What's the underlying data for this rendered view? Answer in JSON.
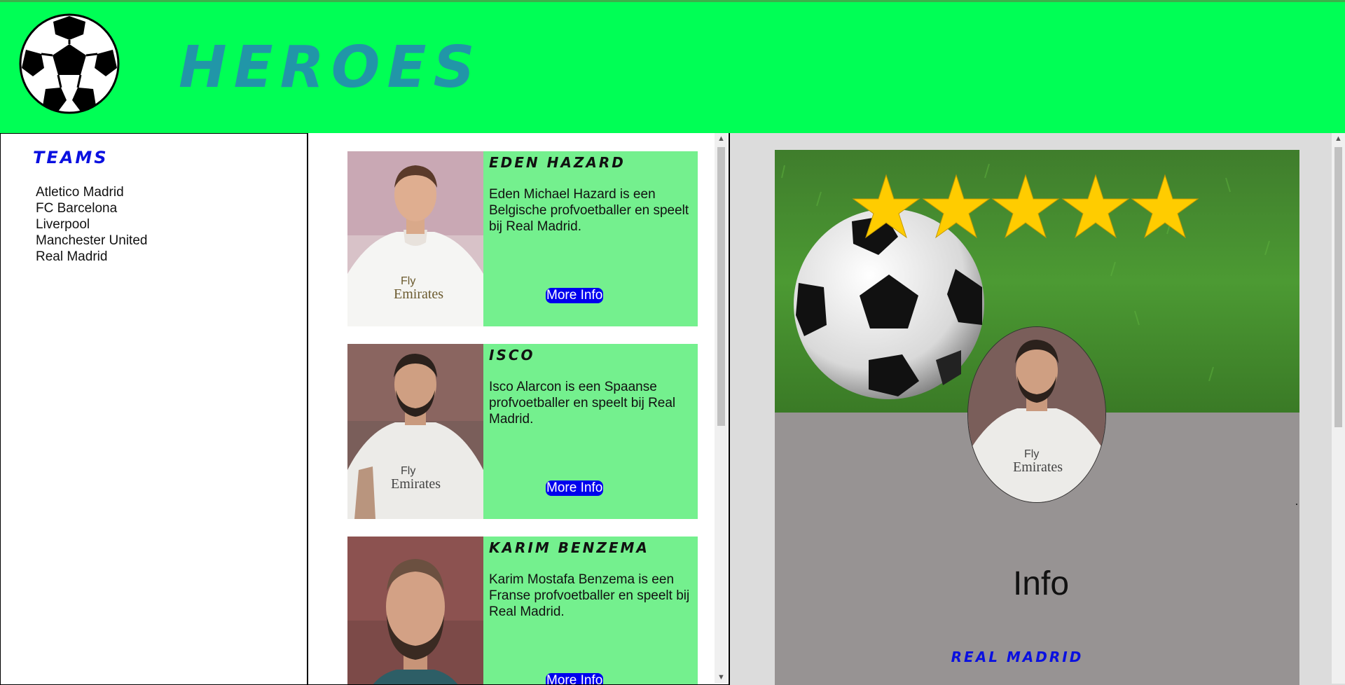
{
  "header": {
    "title": "HEROES",
    "logo_icon": "soccer-ball-icon",
    "background_color": "#00ff55",
    "title_color": "#2196a8"
  },
  "sidebar": {
    "title": "Teams",
    "title_color": "#0a10e0",
    "teams": [
      "Atletico Madrid",
      "FC Barcelona",
      "Liverpool",
      "Manchester United",
      "Real Madrid"
    ]
  },
  "players": [
    {
      "name": "Eden Hazard",
      "description": "Eden Michael Hazard is een Belgische profvoetballer en speelt bij Real Madrid.",
      "button": "More Info"
    },
    {
      "name": "Isco",
      "description": "Isco Alarcon is een Spaanse profvoetballer en speelt bij Real Madrid.",
      "button": "More Info"
    },
    {
      "name": "Karim Benzema",
      "description": "Karim Mostafa Benzema is een Franse profvoetballer en speelt bij Real Madrid.",
      "button": "More Info"
    }
  ],
  "detail": {
    "rating_stars": 5,
    "info_title": "Info",
    "team": "Real Madrid",
    "team_color": "#0a10e0",
    "panel_color": "#979393"
  },
  "colors": {
    "card_background": "#74f08e",
    "button_background": "#0000ee"
  }
}
